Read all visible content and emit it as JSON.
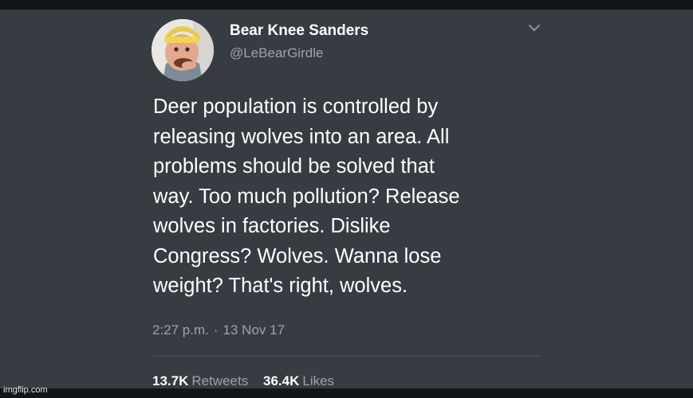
{
  "tweet": {
    "display_name": "Bear Knee Sanders",
    "handle": "@LeBearGirdle",
    "avatar_icon": "user-avatar",
    "menu_icon": "chevron-down-icon",
    "text_lines": [
      "Deer population is controlled by",
      "releasing wolves into an area. All",
      "problems should be solved that",
      "way. Too much pollution? Release",
      "wolves in factories. Dislike",
      "Congress? Wolves. Wanna lose",
      "weight? That's right, wolves."
    ],
    "time": "2:27 p.m.",
    "separator": "·",
    "date": "13 Nov 17",
    "retweets_count": "13.7K",
    "retweets_label": "Retweets",
    "likes_count": "36.4K",
    "likes_label": "Likes"
  },
  "watermark": "imgflip.com",
  "colors": {
    "background": "#373c43",
    "text": "#ffffff",
    "secondary_text": "#9aa3ad",
    "frame": "#131417"
  }
}
